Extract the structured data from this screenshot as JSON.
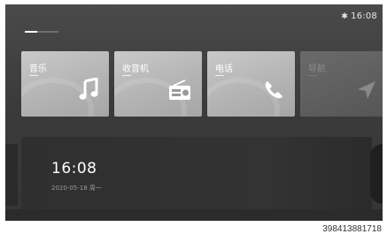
{
  "status": {
    "time": "16:08",
    "bluetooth_icon": "bluetooth-icon"
  },
  "cards": [
    {
      "label": "音乐",
      "icon": "music-note-icon"
    },
    {
      "label": "收音机",
      "icon": "radio-icon"
    },
    {
      "label": "电话",
      "icon": "phone-icon"
    },
    {
      "label": "导航",
      "icon": "navigation-arrow-icon"
    }
  ],
  "clock": {
    "time": "16:08",
    "date": "2020-05-18 周一"
  },
  "watermark": "398413881718"
}
